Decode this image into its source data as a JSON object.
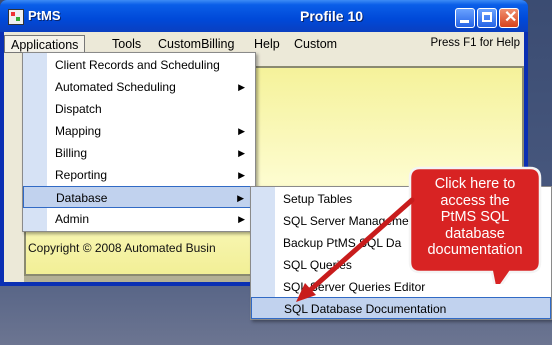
{
  "window": {
    "app_name": "PtMS",
    "title": "Profile 10"
  },
  "menubar": {
    "items": [
      "Applications",
      "Tools",
      "CustomBilling",
      "Help",
      "Custom"
    ],
    "hint": "Press F1 for Help"
  },
  "applications_menu": {
    "items": [
      {
        "label": "Client Records and Scheduling",
        "submenu": false
      },
      {
        "label": "Automated Scheduling",
        "submenu": true
      },
      {
        "label": "Dispatch",
        "submenu": false
      },
      {
        "label": "Mapping",
        "submenu": true
      },
      {
        "label": "Billing",
        "submenu": true
      },
      {
        "label": "Reporting",
        "submenu": true
      },
      {
        "label": "Database",
        "submenu": true,
        "selected": true
      },
      {
        "label": "Admin",
        "submenu": true
      }
    ]
  },
  "database_menu": {
    "items": [
      {
        "label": "Setup Tables"
      },
      {
        "label": "SQL Server Manageme"
      },
      {
        "label": "Backup PtMS SQL Da"
      },
      {
        "label": "SQL Queries"
      },
      {
        "label": "SQL Server Queries Editor"
      },
      {
        "label": "SQL Database Documentation",
        "selected": true
      }
    ]
  },
  "panel": {
    "copyright": "Copyright © 2008 Automated Busin"
  },
  "callout": {
    "lines": [
      "Click here to",
      "access the",
      "PtMS SQL",
      "database",
      "documentation"
    ]
  },
  "colors": {
    "titlebar": "#0a5ee8",
    "callout_fill": "#d82323",
    "arrow": "#c81c1c",
    "selection": "#c1d2ee"
  }
}
